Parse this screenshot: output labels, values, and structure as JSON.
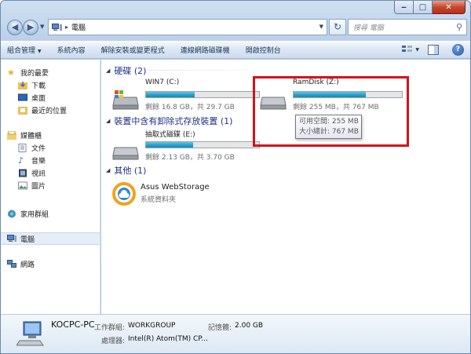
{
  "window": {
    "title_crumb": "電腦",
    "caption": {
      "minimize": "‒",
      "maximize": "□",
      "close": "✕"
    }
  },
  "navbar": {
    "back_icon": "back-arrow-icon",
    "forward_icon": "forward-arrow-icon",
    "refresh_glyph": "↻",
    "search_placeholder": "搜尋 電腦"
  },
  "toolbar": {
    "items": [
      "組合管理",
      "系統內容",
      "解除安裝或變更程式",
      "連線網路磁碟機",
      "開啟控制台"
    ],
    "organize_arrow": "▼"
  },
  "navpane": {
    "favorites": "我的最愛",
    "downloads": "下載",
    "desktop": "桌面",
    "recent": "最近的位置",
    "libraries": "媒體櫃",
    "documents": "文件",
    "music": "音樂",
    "videos": "視訊",
    "pictures": "圖片",
    "homegroup": "家用群組",
    "computer": "電腦",
    "network": "網路"
  },
  "content": {
    "group_hdd": "硬碟 (2)",
    "group_removable": "裝置中含有卸除式存放裝置 (1)",
    "group_other": "其他 (1)",
    "drives": {
      "c": {
        "name": "WIN7 (C:)",
        "info": "剩餘 16.8 GB，共 29.7 GB",
        "used_fraction": 0.43
      },
      "z": {
        "name": "RamDisk (Z:)",
        "info": "剩餘 255 MB，共 767 MB",
        "used_fraction": 0.67
      },
      "e": {
        "name": "抽取式磁碟 (E:)",
        "info": "剩餘 2.13 GB，共 3.70 GB",
        "used_fraction": 0.42
      }
    },
    "tooltip": {
      "free": "可用空間: 255 MB",
      "total": "大小總計: 767 MB"
    },
    "app": {
      "name": "Asus WebStorage",
      "type": "系統資料夾"
    }
  },
  "details": {
    "computer_name": "KOCPC-PC",
    "workgroup_label": "工作群組:",
    "workgroup_value": "WORKGROUP",
    "memory_label": "記憶體:",
    "memory_value": "2.00 GB",
    "processor_label": "處理器:",
    "processor_value": "Intel(R) Atom(TM) CP..."
  },
  "colors": {
    "group_header": "#1e3287",
    "bar_fill": "#2b9ccc",
    "highlight_box": "#d4121a"
  }
}
